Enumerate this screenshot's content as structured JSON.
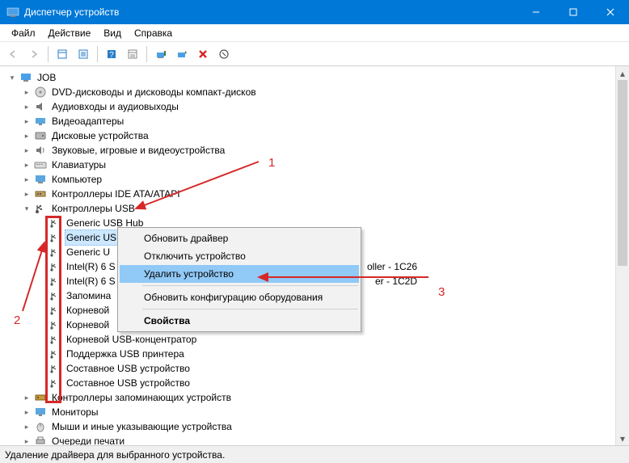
{
  "window": {
    "title": "Диспетчер устройств"
  },
  "menu": {
    "file": "Файл",
    "action": "Действие",
    "view": "Вид",
    "help": "Справка"
  },
  "tree": {
    "root": "JOB",
    "cat_dvd": "DVD-дисководы и дисководы компакт-дисков",
    "cat_audio": "Аудиовходы и аудиовыходы",
    "cat_video": "Видеоадаптеры",
    "cat_disk": "Дисковые устройства",
    "cat_sound": "Звуковые, игровые и видеоустройства",
    "cat_keyb": "Клавиатуры",
    "cat_comp": "Компьютер",
    "cat_ide": "Контроллеры IDE ATA/ATAPI",
    "cat_usb": "Контроллеры USB",
    "usb_generic_hub": "Generic USB Hub",
    "usb_generic_cut1": "Generic US",
    "usb_generic_cut2": "Generic U",
    "usb_intel_s1": "Intel(R) 6 S",
    "usb_intel_s1_tail": "oller - 1C26",
    "usb_intel_s2": "Intel(R) 6 S",
    "usb_intel_s2_tail": "er - 1C2D",
    "usb_mem": "Запомина",
    "usb_root1": "Корневой",
    "usb_root2": "Корневой",
    "usb_roothub": "Корневой USB-концентратор",
    "usb_printer": "Поддержка USB принтера",
    "usb_comp1": "Составное USB устройство",
    "usb_comp2": "Составное USB устройство",
    "cat_storage": "Контроллеры запоминающих устройств",
    "cat_monitor": "Мониторы",
    "cat_mouse": "Мыши и иные указывающие устройства",
    "cat_print": "Очереди печати"
  },
  "context_menu": {
    "update": "Обновить драйвер",
    "disable": "Отключить устройство",
    "uninstall": "Удалить устройство",
    "scan": "Обновить конфигурацию оборудования",
    "props": "Свойства"
  },
  "status": "Удаление драйвера для выбранного устройства.",
  "annotations": {
    "n1": "1",
    "n2": "2",
    "n3": "3"
  }
}
